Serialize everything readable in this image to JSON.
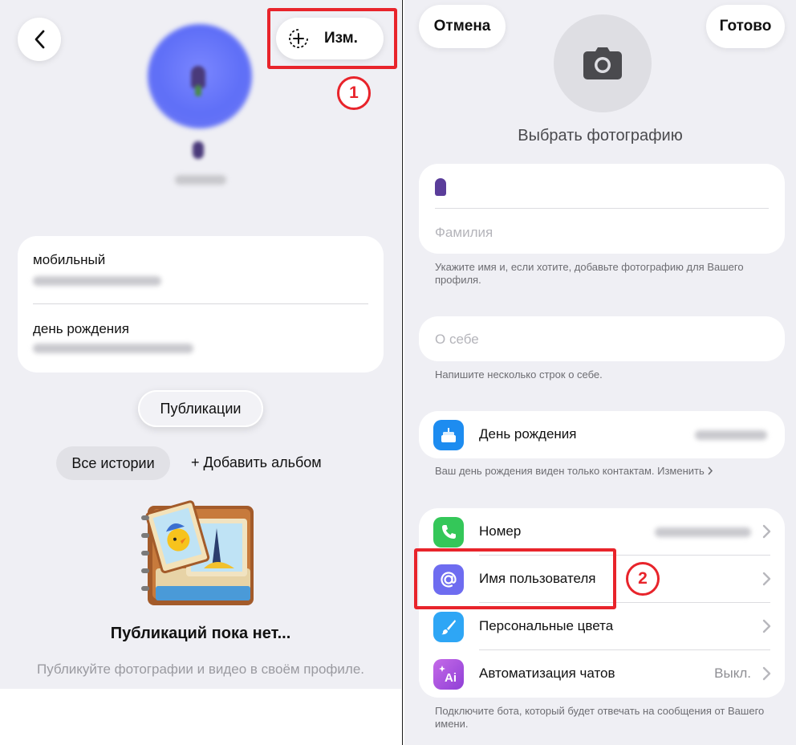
{
  "left": {
    "edit_label": "Изм.",
    "info": [
      {
        "label": "мобильный"
      },
      {
        "label": "день рождения"
      }
    ],
    "publications_button": "Публикации",
    "stories_chip": "Все истории",
    "add_album": "+ Добавить альбом",
    "empty_title": "Публикаций пока нет...",
    "empty_subtitle": "Публикуйте фотографии и видео в своём профиле.",
    "badge": "1"
  },
  "right": {
    "cancel": "Отмена",
    "done": "Готово",
    "choose_photo": "Выбрать фотографию",
    "lastname_placeholder": "Фамилия",
    "name_hint": "Укажите имя и, если хотите, добавьте фотографию для Вашего профиля.",
    "about_placeholder": "О себе",
    "about_hint": "Напишите несколько строк о себе.",
    "birthday_label": "День рождения",
    "birthday_hint": "Ваш день рождения виден только контактам. Изменить",
    "rows": [
      {
        "label": "Номер",
        "value": ""
      },
      {
        "label": "Имя пользователя",
        "value": ""
      },
      {
        "label": "Персональные цвета",
        "value": ""
      },
      {
        "label": "Автоматизация чатов",
        "value": "Выкл."
      }
    ],
    "bot_hint": "Подключите бота, который будет отвечать на сообщения от Вашего имени.",
    "badge": "2"
  },
  "colors": {
    "highlight": "#e8242b",
    "background": "#efeff4",
    "phone_icon": "#34c759",
    "username_icon": "#6e6cf0",
    "colors_icon": "#2ea6f5",
    "automation_icon": "#b45be6",
    "birthday_icon": "#1d8cf0"
  }
}
